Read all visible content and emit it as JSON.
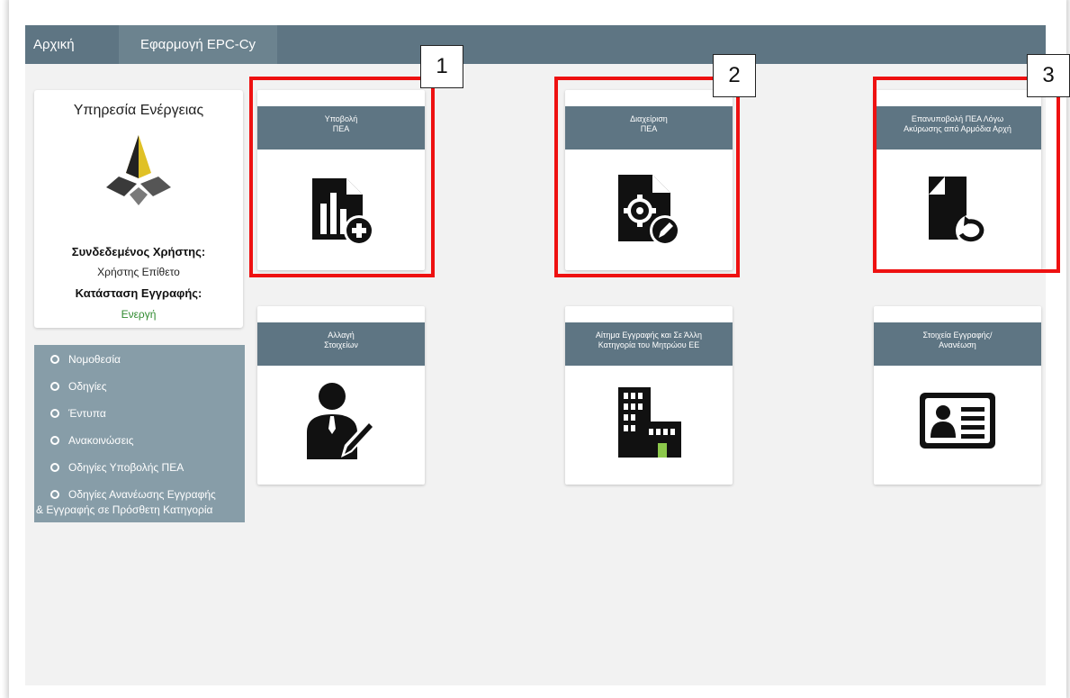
{
  "nav": {
    "home": "Αρχική",
    "app": "Εφαρμογή EPC-Cy"
  },
  "user_card": {
    "service": "Υπηρεσία Ενέργειας",
    "connected_label": "Συνδεδεμένος Χρήστης:",
    "user_name": "Χρήστης Επίθετο",
    "status_label": "Κατάσταση Εγγραφής:",
    "status_value": "Ενεργή"
  },
  "sidebar": {
    "items": [
      {
        "label": "Νομοθεσία"
      },
      {
        "label": "Οδηγίες"
      },
      {
        "label": "Έντυπα"
      },
      {
        "label": "Ανακοινώσεις"
      },
      {
        "label": "Οδηγίες Υποβολής ΠΕΑ"
      },
      {
        "label": "Οδηγίες Ανανέωσης Εγγραφής"
      },
      {
        "label": "& Εγγραφής σε Πρόσθετη Κατηγορία"
      }
    ]
  },
  "tiles": [
    {
      "title": "Υποβολή\nΠΕΑ",
      "icon": "chart-document-add-icon"
    },
    {
      "title": "Διαχείριση\nΠΕΑ",
      "icon": "document-settings-edit-icon"
    },
    {
      "title": "Επανυποβολή ΠΕΑ Λόγω\nΑκύρωσης από Αρμόδια Αρχή",
      "icon": "document-resubmit-icon"
    },
    {
      "title": "Αλλαγή\nΣτοιχείων",
      "icon": "user-edit-icon"
    },
    {
      "title": "Αίτημα Εγγραφής και Σε Άλλη\nΚατηγορία του Μητρώου ΕΕ",
      "icon": "buildings-icon"
    },
    {
      "title": "Στοιχεία Εγγραφής/\nΑνανέωση",
      "icon": "id-card-icon"
    }
  ],
  "callouts": [
    "1",
    "2",
    "3"
  ],
  "colors": {
    "nav": "#5e7583",
    "sidebar": "#879da8",
    "highlight": "#ee1111",
    "status": "#2f8a2f"
  }
}
